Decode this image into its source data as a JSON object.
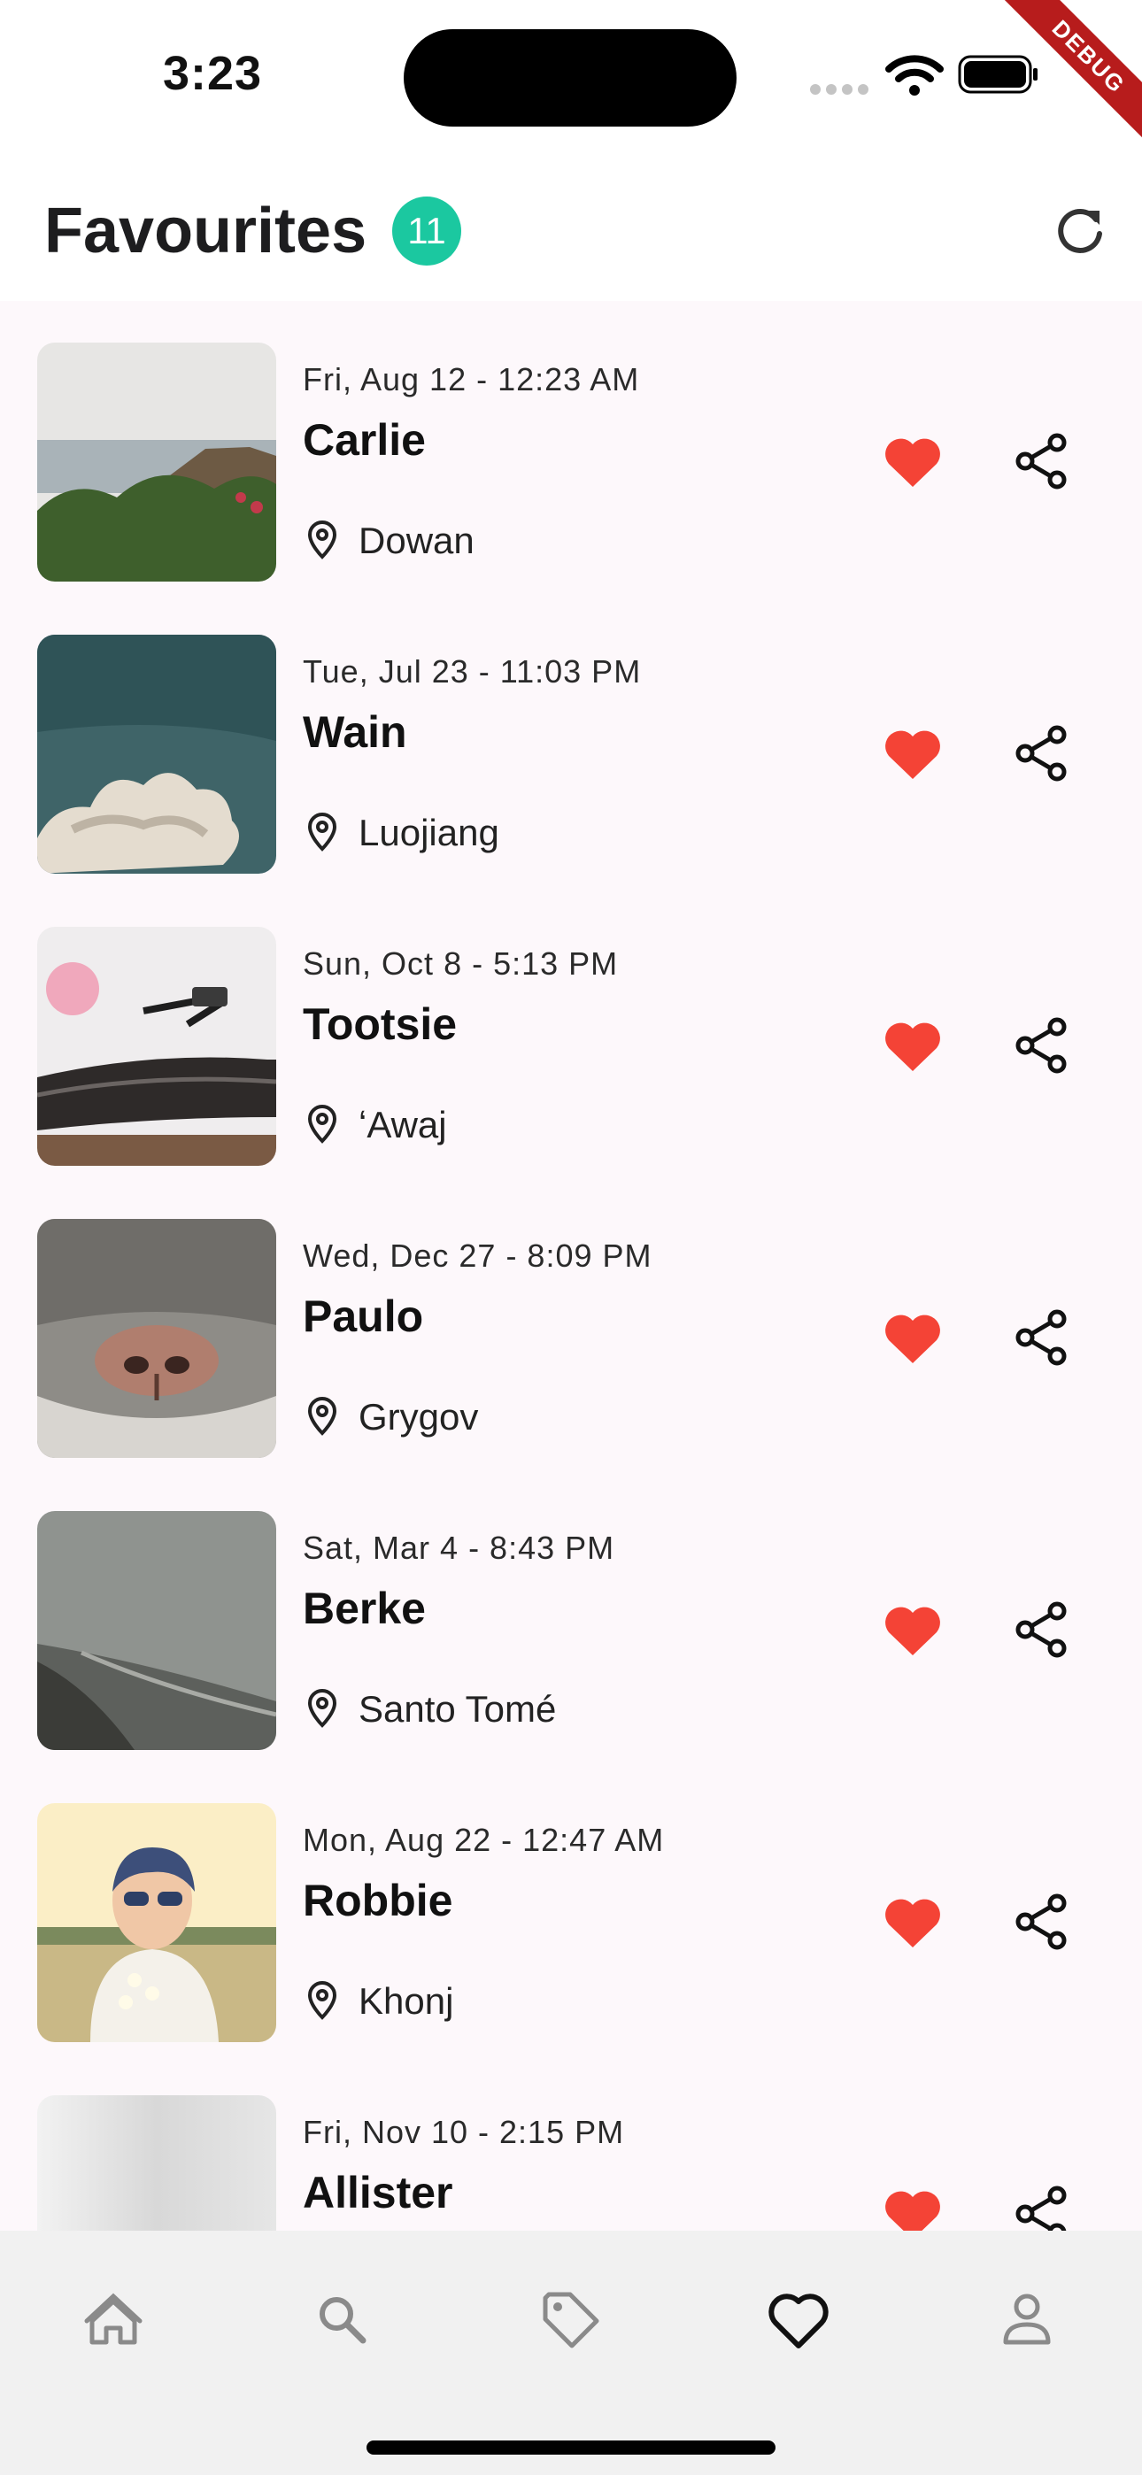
{
  "status_bar": {
    "time": "3:23"
  },
  "debug_label": "DEBUG",
  "header": {
    "title": "Favourites",
    "count": "11"
  },
  "colors": {
    "accent": "#1bc8a0",
    "heart": "#f44336",
    "debug": "#b71c1c"
  },
  "favourites": [
    {
      "date": "Fri, Aug 12 - 12:23 AM",
      "name": "Carlie",
      "location": "Dowan"
    },
    {
      "date": "Tue, Jul 23 - 11:03 PM",
      "name": "Wain",
      "location": "Luojiang"
    },
    {
      "date": "Sun, Oct 8 - 5:13 PM",
      "name": "Tootsie",
      "location": "ʻAwaj"
    },
    {
      "date": "Wed, Dec 27 - 8:09 PM",
      "name": "Paulo",
      "location": "Grygov"
    },
    {
      "date": "Sat, Mar 4 - 8:43 PM",
      "name": "Berke",
      "location": "Santo Tomé"
    },
    {
      "date": "Mon, Aug 22 - 12:47 AM",
      "name": "Robbie",
      "location": "Khonj"
    },
    {
      "date": "Fri, Nov 10 - 2:15 PM",
      "name": "Allister",
      "location": ""
    }
  ],
  "bottom_nav": {
    "items": [
      "home-icon",
      "search-icon",
      "tag-icon",
      "heart-icon",
      "person-icon"
    ],
    "active": "heart-icon"
  }
}
